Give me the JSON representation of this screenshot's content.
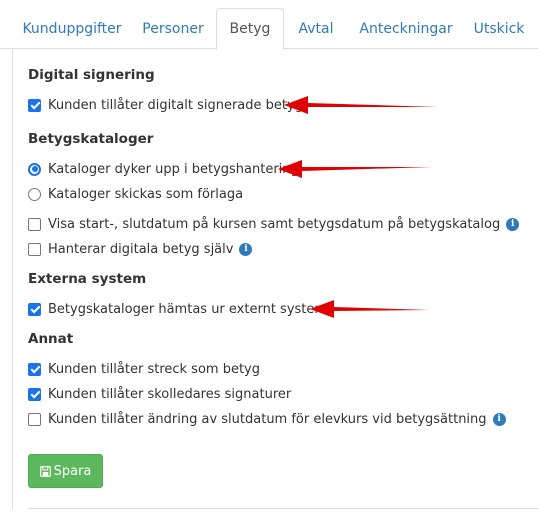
{
  "tabs": [
    {
      "label": "Kunduppgifter",
      "active": false
    },
    {
      "label": "Personer",
      "active": false
    },
    {
      "label": "Betyg",
      "active": true
    },
    {
      "label": "Avtal",
      "active": false
    },
    {
      "label": "Anteckningar",
      "active": false
    },
    {
      "label": "Utskick",
      "active": false
    }
  ],
  "sections": {
    "digital": {
      "heading": "Digital signering",
      "options": [
        {
          "label": "Kunden tillåter digitalt signerade betyg",
          "checked": true
        }
      ]
    },
    "kataloger": {
      "heading": "Betygskataloger",
      "radios": [
        {
          "label": "Kataloger dyker upp i betygshantering",
          "checked": true
        },
        {
          "label": "Kataloger skickas som förlaga",
          "checked": false
        }
      ],
      "options": [
        {
          "label": "Visa start-, slutdatum på kursen samt betygsdatum på betygskatalog",
          "checked": false,
          "info": "i"
        },
        {
          "label": "Hanterar digitala betyg själv",
          "checked": false,
          "info": "i"
        }
      ]
    },
    "externa": {
      "heading": "Externa system",
      "options": [
        {
          "label": "Betygskataloger hämtas ur externt system",
          "checked": true
        }
      ]
    },
    "annat": {
      "heading": "Annat",
      "options": [
        {
          "label": "Kunden tillåter streck som betyg",
          "checked": true
        },
        {
          "label": "Kunden tillåter skolledares signaturer",
          "checked": true
        },
        {
          "label": "Kunden tillåter ändring av slutdatum för elevkurs vid betygsättning",
          "checked": false,
          "info": "i"
        }
      ]
    }
  },
  "save_button": {
    "label": "Spara",
    "icon": "floppy-disk-icon"
  },
  "colors": {
    "accent": "#1a73e8",
    "link": "#2f7ab9",
    "success": "#5cb85c",
    "annotation": "#e00000"
  }
}
